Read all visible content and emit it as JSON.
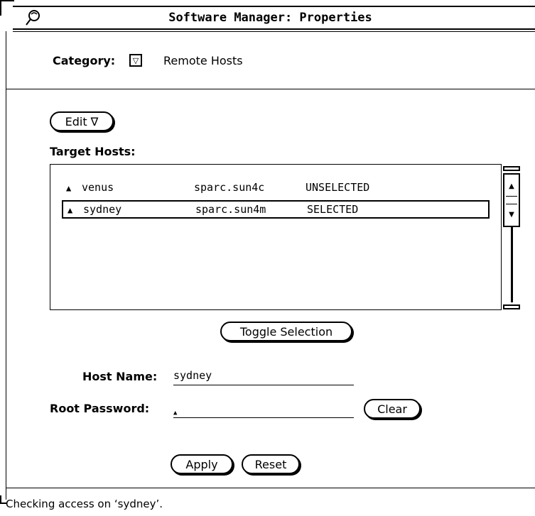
{
  "window": {
    "title": "Software Manager: Properties"
  },
  "category": {
    "label": "Category:",
    "value": "Remote Hosts"
  },
  "edit_menu": {
    "label": "Edit ∇"
  },
  "target_hosts": {
    "label": "Target Hosts:",
    "rows": [
      {
        "name": "venus",
        "arch": "sparc.sun4c",
        "state": "UNSELECTED"
      },
      {
        "name": "sydney",
        "arch": "sparc.sun4m",
        "state": "SELECTED"
      }
    ],
    "selected_index": 1
  },
  "toggle_button": {
    "label": "Toggle Selection"
  },
  "host_name": {
    "label": "Host Name:",
    "value": "sydney"
  },
  "root_password": {
    "label": "Root Password:",
    "value": ""
  },
  "clear_button": {
    "label": "Clear"
  },
  "apply_button": {
    "label": "Apply"
  },
  "reset_button": {
    "label": "Reset"
  },
  "status": {
    "message": "Checking access on ‘sydney’."
  },
  "icons": {
    "window_menu": "window-menu-icon",
    "host": "host-icon",
    "dropdown": "triangle-down-icon",
    "scroll_up": "arrow-up-icon",
    "scroll_down": "arrow-down-icon"
  }
}
